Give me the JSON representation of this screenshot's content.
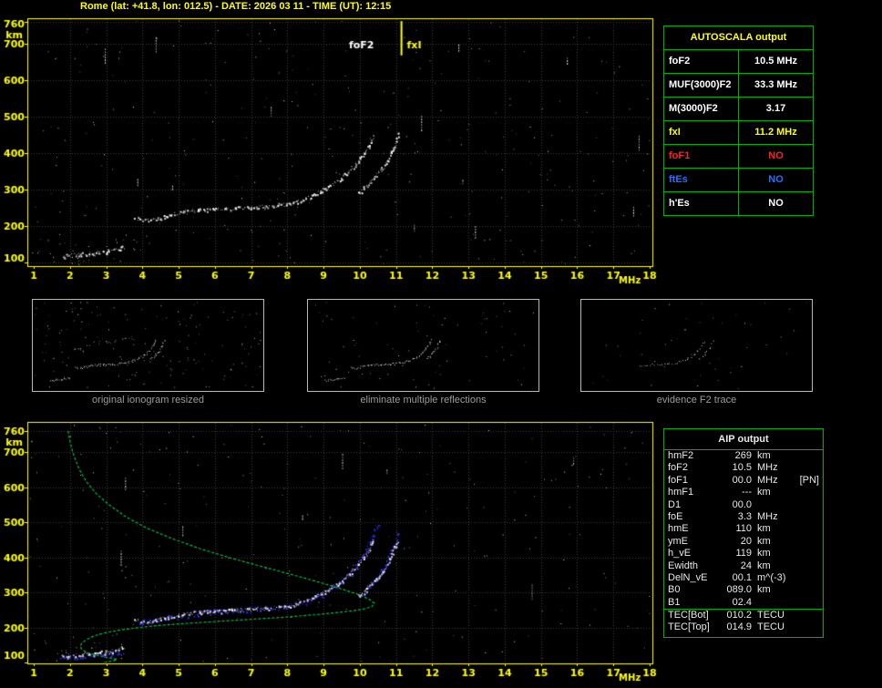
{
  "title": "Rome (lat: +41.8, lon: 012.5) - DATE: 2026 03 11 - TIME (UT): 12:15",
  "colors": {
    "accent": "#ffff00",
    "table_border": "#00b000",
    "trace": "#ffffff",
    "restored_trace": "#3333ff",
    "profile": "#00c040",
    "grid": "#3b3b3b",
    "caption": "#9b9b9b",
    "no_red": "#ff2020",
    "no_blue": "#2e6bff"
  },
  "autoscala": {
    "header": "AUTOSCALA output",
    "rows": [
      {
        "label": "foF2",
        "value": "10.5 MHz",
        "color": "#ffffff"
      },
      {
        "label": "MUF(3000)F2",
        "value": "33.3 MHz",
        "color": "#ffffff"
      },
      {
        "label": "M(3000)F2",
        "value": "3.17",
        "color": "#ffffff"
      },
      {
        "label": "fxI",
        "value": "11.2 MHz",
        "color": "#ffff00"
      },
      {
        "label": "foF1",
        "value": "NO",
        "color": "#ff2020"
      },
      {
        "label": "ftEs",
        "value": "NO",
        "color": "#2e6bff"
      },
      {
        "label": "h'Es",
        "value": "NO",
        "color": "#ffffff"
      }
    ]
  },
  "thumbnails": [
    {
      "caption": "original ionogram resized"
    },
    {
      "caption": "eliminate multiple reflections"
    },
    {
      "caption": "evidence F2 trace"
    }
  ],
  "aip": {
    "header": "AIP output",
    "rows": [
      {
        "label": "hmF2",
        "value": "269",
        "unit": "km",
        "extra": ""
      },
      {
        "label": "foF2",
        "value": "10.5",
        "unit": "MHz",
        "extra": ""
      },
      {
        "label": "foF1",
        "value": "00.0",
        "unit": "MHz",
        "extra": "[PN]"
      },
      {
        "label": "hmF1",
        "value": "---",
        "unit": "km",
        "extra": ""
      },
      {
        "label": "D1",
        "value": "00.0",
        "unit": "",
        "extra": ""
      },
      {
        "label": "foE",
        "value": "3.3",
        "unit": "MHz",
        "extra": ""
      },
      {
        "label": "hmE",
        "value": "110",
        "unit": "km",
        "extra": ""
      },
      {
        "label": "ymE",
        "value": "20",
        "unit": "km",
        "extra": ""
      },
      {
        "label": "h_vE",
        "value": "119",
        "unit": "km",
        "extra": ""
      },
      {
        "label": "Ewidth",
        "value": "24",
        "unit": "km",
        "extra": ""
      },
      {
        "label": "DelN_vE",
        "value": "00.1",
        "unit": "m^(-3)",
        "extra": ""
      },
      {
        "label": "B0",
        "value": "089.0",
        "unit": "km",
        "extra": ""
      },
      {
        "label": "B1",
        "value": "02.4",
        "unit": "",
        "extra": ""
      },
      {
        "label": "TEC[Bot]",
        "value": "010.2",
        "unit": "TECU",
        "extra": "",
        "sep": true
      },
      {
        "label": "TEC[Top]",
        "value": "014.9",
        "unit": "TECU",
        "extra": ""
      }
    ]
  },
  "chart_data": [
    {
      "id": "ionogram",
      "type": "scatter",
      "title": "",
      "xlabel": "MHz",
      "ylabel": "km",
      "x_range": [
        1,
        18
      ],
      "y_range": [
        90,
        770
      ],
      "x_ticks": [
        1,
        2,
        3,
        4,
        5,
        6,
        7,
        8,
        9,
        10,
        11,
        12,
        13,
        14,
        15,
        16,
        17,
        18
      ],
      "y_ticks": [
        100,
        200,
        300,
        400,
        500,
        600,
        700,
        760
      ],
      "grid": true,
      "annotations": [
        {
          "type": "text",
          "text": "foF2",
          "x": 9.7,
          "y": 688,
          "color": "#ffffff"
        },
        {
          "type": "text",
          "text": "fxI",
          "x": 11.3,
          "y": 688,
          "color": "#ffff00"
        },
        {
          "type": "vline",
          "x": 11.15,
          "y1": 762,
          "y2": 668,
          "color": "#ffff00"
        }
      ],
      "series": [
        {
          "name": "E region echo trace",
          "color": "#ffffff",
          "jitter": 1.8,
          "size": 2,
          "points": [
            [
              1.8,
              118
            ],
            [
              2.1,
              121
            ],
            [
              2.4,
              124
            ],
            [
              2.75,
              127
            ],
            [
              3.05,
              131
            ],
            [
              3.3,
              135
            ],
            [
              3.45,
              143
            ]
          ]
        },
        {
          "name": "F2 ordinary trace",
          "color": "#ffffff",
          "jitter": 1.6,
          "size": 2,
          "points": [
            [
              3.8,
              222
            ],
            [
              4.05,
              215
            ],
            [
              4.3,
              218
            ],
            [
              4.7,
              228
            ],
            [
              5.1,
              238
            ],
            [
              5.5,
              243
            ],
            [
              5.9,
              246
            ],
            [
              6.3,
              248
            ],
            [
              6.7,
              250
            ],
            [
              7.1,
              252
            ],
            [
              7.5,
              255
            ],
            [
              7.9,
              260
            ],
            [
              8.3,
              268
            ],
            [
              8.6,
              280
            ],
            [
              8.9,
              295
            ],
            [
              9.2,
              312
            ],
            [
              9.45,
              330
            ],
            [
              9.7,
              350
            ],
            [
              9.9,
              372
            ],
            [
              10.05,
              392
            ],
            [
              10.2,
              415
            ],
            [
              10.3,
              435
            ],
            [
              10.38,
              452
            ]
          ]
        },
        {
          "name": "F2 extraordinary trace",
          "color": "#ffffff",
          "jitter": 1.5,
          "size": 2,
          "points": [
            [
              9.95,
              290
            ],
            [
              10.15,
              308
            ],
            [
              10.35,
              328
            ],
            [
              10.55,
              350
            ],
            [
              10.7,
              372
            ],
            [
              10.82,
              394
            ],
            [
              10.92,
              418
            ],
            [
              11.0,
              438
            ],
            [
              11.06,
              455
            ]
          ]
        }
      ]
    },
    {
      "id": "restored_ionogram_with_profile",
      "type": "scatter",
      "title": "",
      "xlabel": "MHz",
      "ylabel": "km",
      "x_range": [
        1,
        18
      ],
      "y_range": [
        97,
        785
      ],
      "x_ticks": [
        1,
        2,
        3,
        4,
        5,
        6,
        7,
        8,
        9,
        10,
        11,
        12,
        13,
        14,
        15,
        16,
        17,
        18
      ],
      "y_ticks": [
        100,
        200,
        300,
        400,
        500,
        600,
        700,
        760
      ],
      "grid": true,
      "annotations": [],
      "series": [
        {
          "name": "electron density profile",
          "color": "#00c040",
          "mode": "line",
          "points": [
            [
              1.95,
              760
            ],
            [
              2.0,
              730
            ],
            [
              2.1,
              692
            ],
            [
              2.25,
              652
            ],
            [
              2.45,
              616
            ],
            [
              2.72,
              582
            ],
            [
              3.05,
              552
            ],
            [
              3.5,
              518
            ],
            [
              4.1,
              484
            ],
            [
              4.8,
              454
            ],
            [
              5.6,
              424
            ],
            [
              6.5,
              396
            ],
            [
              7.5,
              368
            ],
            [
              8.5,
              340
            ],
            [
              9.3,
              316
            ],
            [
              9.9,
              296
            ],
            [
              10.25,
              281
            ],
            [
              10.4,
              269
            ],
            [
              10.33,
              259
            ],
            [
              10.05,
              251
            ],
            [
              9.55,
              244
            ],
            [
              8.85,
              237
            ],
            [
              8.05,
              230
            ],
            [
              7.15,
              224
            ],
            [
              6.2,
              218
            ],
            [
              5.3,
              212
            ],
            [
              4.5,
              206
            ],
            [
              3.85,
              199
            ],
            [
              3.35,
              192
            ],
            [
              2.95,
              184
            ],
            [
              2.65,
              175
            ],
            [
              2.45,
              165
            ],
            [
              2.33,
              155
            ],
            [
              2.28,
              146
            ],
            [
              2.33,
              137
            ],
            [
              2.48,
              128
            ],
            [
              2.72,
              121
            ],
            [
              3.0,
              115
            ],
            [
              3.2,
              111
            ],
            [
              3.3,
              109
            ],
            [
              3.2,
              105
            ],
            [
              2.95,
              100
            ],
            [
              2.6,
              95
            ],
            [
              2.2,
              89
            ],
            [
              1.85,
              82
            ],
            [
              1.55,
              75
            ],
            [
              1.3,
              68
            ],
            [
              1.1,
              61
            ],
            [
              1.0,
              56
            ]
          ]
        },
        {
          "name": "autoscaled trace E",
          "color": "#3333ff",
          "jitter": 2.2,
          "size": 2,
          "points": [
            [
              1.75,
              114
            ],
            [
              2.1,
              117
            ],
            [
              2.5,
              120
            ],
            [
              2.9,
              123
            ],
            [
              3.25,
              127
            ],
            [
              3.45,
              132
            ]
          ]
        },
        {
          "name": "autoscaled trace F2 o-mode",
          "color": "#3333ff",
          "jitter": 2.4,
          "size": 2,
          "points": [
            [
              3.85,
              220
            ],
            [
              4.3,
              218
            ],
            [
              4.8,
              230
            ],
            [
              5.4,
              240
            ],
            [
              6.0,
              246
            ],
            [
              6.6,
              249
            ],
            [
              7.2,
              252
            ],
            [
              7.8,
              258
            ],
            [
              8.3,
              268
            ],
            [
              8.7,
              282
            ],
            [
              9.05,
              300
            ],
            [
              9.35,
              320
            ],
            [
              9.6,
              342
            ],
            [
              9.8,
              364
            ],
            [
              9.98,
              388
            ],
            [
              10.12,
              412
            ],
            [
              10.25,
              438
            ],
            [
              10.38,
              465
            ],
            [
              10.5,
              495
            ]
          ]
        },
        {
          "name": "autoscaled trace F2 x-mode",
          "color": "#3333ff",
          "jitter": 2.0,
          "size": 2,
          "points": [
            [
              10.0,
              292
            ],
            [
              10.3,
              322
            ],
            [
              10.55,
              352
            ],
            [
              10.75,
              385
            ],
            [
              10.9,
              420
            ],
            [
              11.0,
              450
            ],
            [
              11.05,
              478
            ]
          ]
        },
        {
          "name": "E region echo trace",
          "color": "#ffffff",
          "jitter": 1.8,
          "size": 2,
          "points": [
            [
              1.8,
              118
            ],
            [
              2.1,
              121
            ],
            [
              2.4,
              124
            ],
            [
              2.75,
              127
            ],
            [
              3.05,
              131
            ],
            [
              3.3,
              135
            ],
            [
              3.45,
              143
            ]
          ]
        },
        {
          "name": "F2 ordinary trace",
          "color": "#ffffff",
          "jitter": 1.6,
          "size": 2,
          "points": [
            [
              3.8,
              222
            ],
            [
              4.05,
              215
            ],
            [
              4.3,
              218
            ],
            [
              4.7,
              228
            ],
            [
              5.1,
              238
            ],
            [
              5.5,
              243
            ],
            [
              5.9,
              246
            ],
            [
              6.3,
              248
            ],
            [
              6.7,
              250
            ],
            [
              7.1,
              252
            ],
            [
              7.5,
              255
            ],
            [
              7.9,
              260
            ],
            [
              8.3,
              268
            ],
            [
              8.6,
              280
            ],
            [
              8.9,
              295
            ],
            [
              9.2,
              312
            ],
            [
              9.45,
              330
            ],
            [
              9.7,
              350
            ],
            [
              9.9,
              372
            ],
            [
              10.05,
              392
            ],
            [
              10.2,
              415
            ],
            [
              10.3,
              435
            ],
            [
              10.38,
              452
            ]
          ]
        },
        {
          "name": "F2 extraordinary trace",
          "color": "#ffffff",
          "jitter": 1.5,
          "size": 2,
          "points": [
            [
              9.95,
              290
            ],
            [
              10.15,
              308
            ],
            [
              10.35,
              328
            ],
            [
              10.55,
              350
            ],
            [
              10.7,
              372
            ],
            [
              10.82,
              394
            ],
            [
              10.92,
              418
            ],
            [
              11.0,
              438
            ],
            [
              11.06,
              455
            ]
          ]
        }
      ]
    }
  ]
}
